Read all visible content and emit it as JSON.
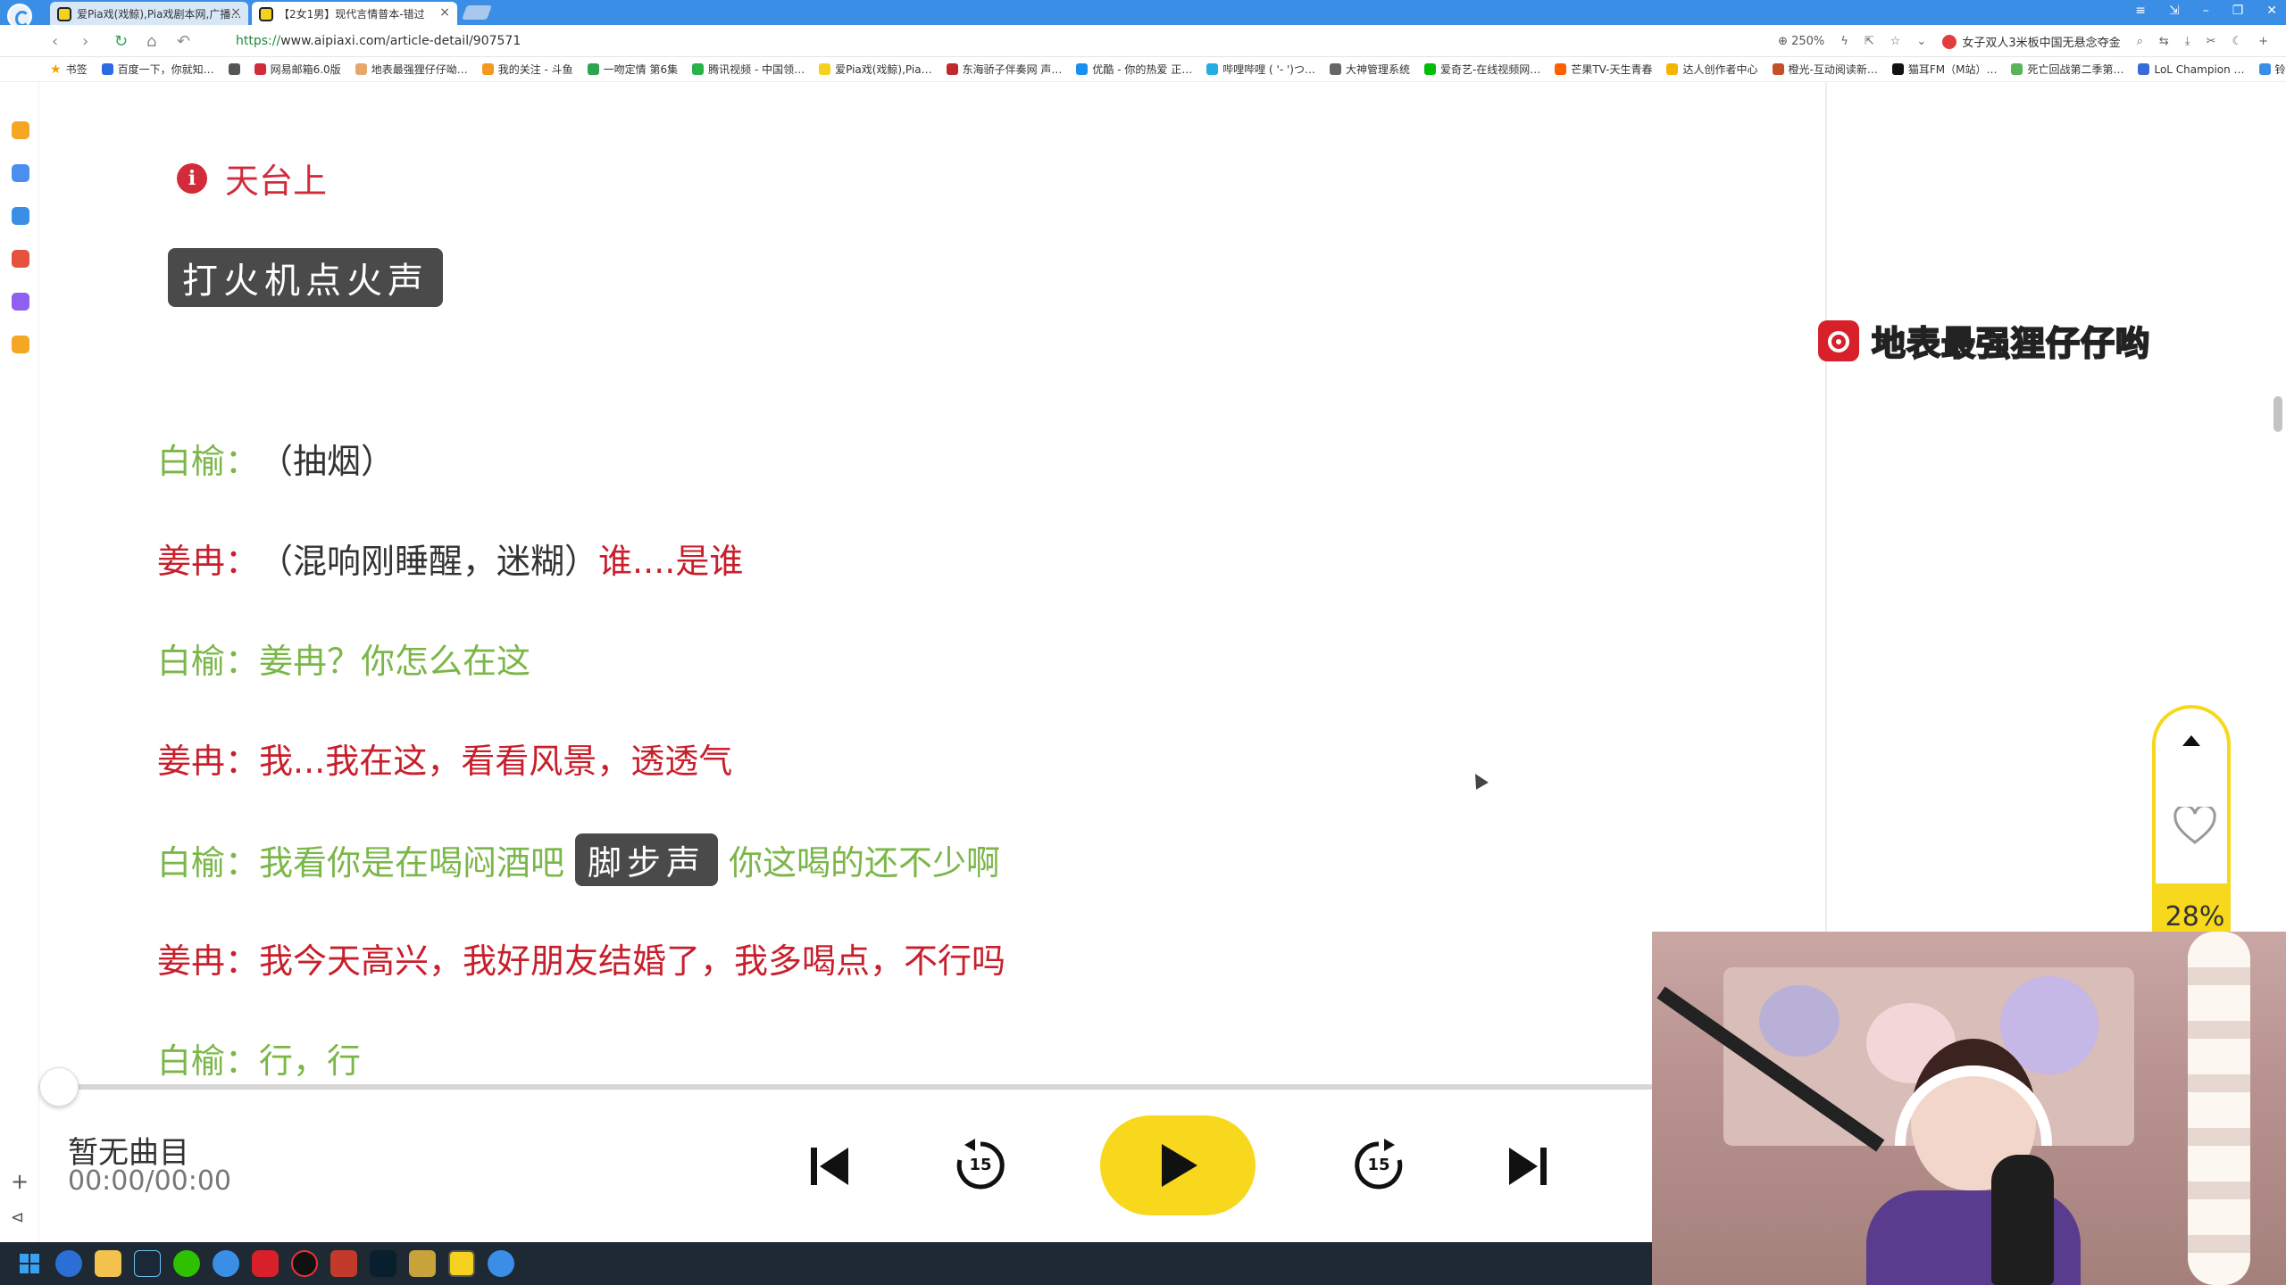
{
  "browser": {
    "tabs": [
      {
        "title": "爱Pia戏(戏鲸),Pia戏剧本网,广播…",
        "active": false
      },
      {
        "title": "【2女1男】现代言情普本-错过",
        "active": true
      }
    ],
    "window_controls": [
      "≡",
      "⇲",
      "–",
      "❐",
      "✕"
    ],
    "url_scheme": "https://",
    "url_rest": "www.aipiaxi.com/article-detail/907571",
    "zoom": "250%",
    "search_suggestion": "女子双人3米板中国无悬念夺金"
  },
  "bookmarks": [
    "书签",
    "百度一下，你就知…",
    "网易邮箱6.0版",
    "地表最强狸仔仔呦…",
    "我的关注 - 斗鱼",
    "一吻定情 第6集",
    "腾讯视频 - 中国领…",
    "爱Pia戏(戏鲸),Pia…",
    "东海骄子伴奏网 声…",
    "优酷 - 你的热爱 正…",
    "哔哩哔哩 ( '- ')つ…",
    "大神管理系统",
    "爱奇艺-在线视频网…",
    "芒果TV-天生青春",
    "达人创作者中心",
    "橙光-互动阅读新…",
    "猫耳FM（M站）…",
    "死亡回战第二季第…",
    "LoL Champion …",
    "铃芽之旅 - 在…"
  ],
  "script": {
    "scene_title": "天台上",
    "opening_sfx": "打火机点火声",
    "lines": [
      {
        "speaker": "白榆：",
        "speaker_color": "#7ab648",
        "parts": [
          {
            "text": "（抽烟）",
            "kind": "neutral"
          }
        ]
      },
      {
        "speaker": "姜冉：",
        "speaker_color": "#c81f2c",
        "parts": [
          {
            "text": "（混响刚睡醒，迷糊）",
            "kind": "neutral"
          },
          {
            "text": "谁....是谁",
            "kind": "jiang"
          }
        ]
      },
      {
        "speaker": "白榆：",
        "speaker_color": "#7ab648",
        "parts": [
          {
            "text": "姜冉？你怎么在这",
            "kind": "bai"
          }
        ]
      },
      {
        "speaker": "姜冉：",
        "speaker_color": "#c81f2c",
        "parts": [
          {
            "text": "我...我在这，看看风景，透透气",
            "kind": "jiang"
          }
        ]
      },
      {
        "speaker": "白榆：",
        "speaker_color": "#7ab648",
        "parts": [
          {
            "text": "我看你是在喝闷酒吧",
            "kind": "bai"
          },
          {
            "text": "脚步声",
            "kind": "sfx"
          },
          {
            "text": "你这喝的还不少啊",
            "kind": "bai"
          }
        ]
      },
      {
        "speaker": "姜冉：",
        "speaker_color": "#c81f2c",
        "parts": [
          {
            "text": "我今天高兴，我好朋友结婚了，我多喝点，不行吗",
            "kind": "jiang"
          }
        ]
      },
      {
        "speaker": "白榆：",
        "speaker_color": "#7ab648",
        "parts": [
          {
            "text": "行，行",
            "kind": "bai"
          }
        ]
      }
    ]
  },
  "player": {
    "track_title": "暂无曲目",
    "track_time": "00:00/00:00",
    "progress": 0,
    "skip_seconds": "15"
  },
  "overlay": {
    "netease_name": "地表最强狸仔仔哟",
    "reading_progress": "28%"
  },
  "colors": {
    "accent_yellow": "#f7d81d",
    "speaker_bai": "#7ab648",
    "speaker_jiang": "#c81f2c",
    "browser_blue": "#3a8ee6"
  }
}
